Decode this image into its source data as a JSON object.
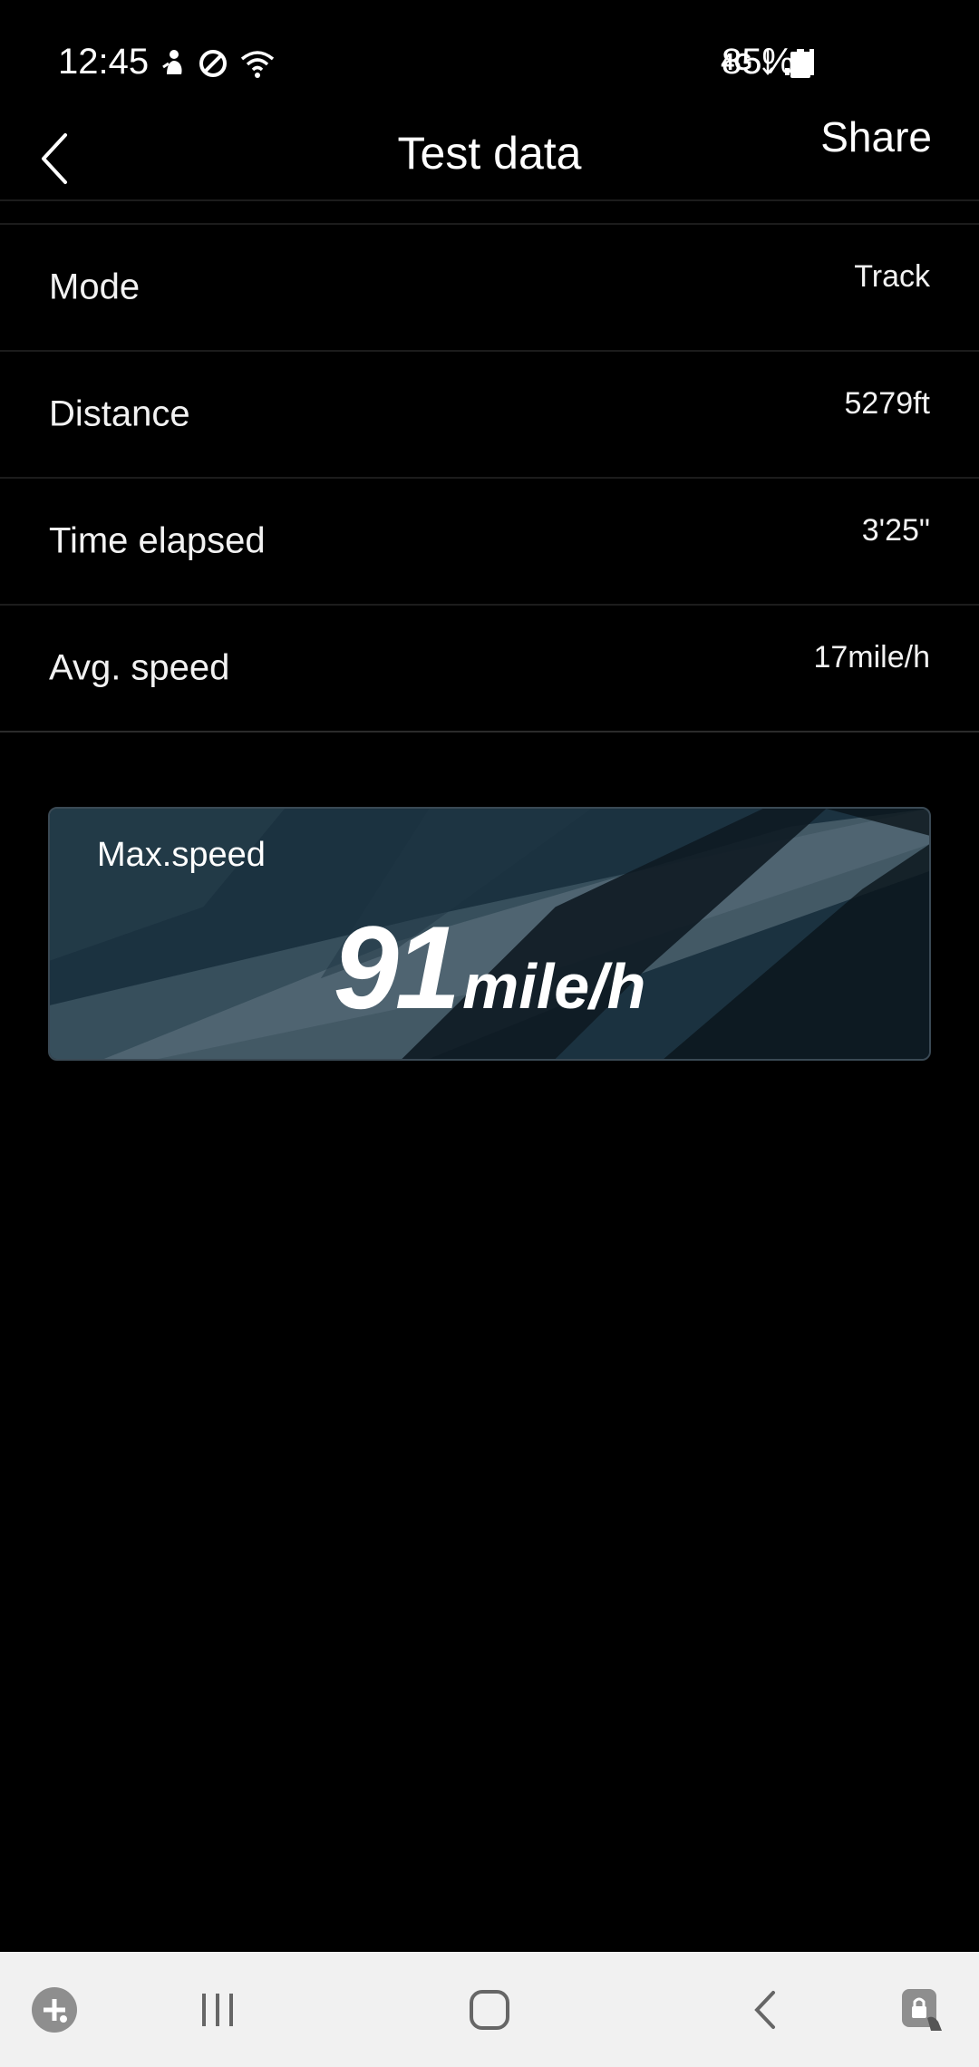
{
  "status_bar": {
    "time": "12:45",
    "network": "4G",
    "battery": "85%"
  },
  "header": {
    "title": "Test data",
    "share_label": "Share"
  },
  "rows": [
    {
      "label": "Mode",
      "value": "Track"
    },
    {
      "label": "Distance",
      "value": "5279ft"
    },
    {
      "label": "Time elapsed",
      "value": "3'25\""
    },
    {
      "label": "Avg. speed",
      "value": "17mile/h"
    }
  ],
  "max_speed": {
    "label": "Max.speed",
    "value": "91",
    "unit": "mile/h"
  },
  "icons": {
    "back": "chevron-left-icon",
    "game": "game-launcher-icon",
    "recents": "recents-icon",
    "home": "home-icon",
    "nav_back": "back-icon",
    "lock": "lock-icon"
  },
  "colors": {
    "background": "#000000",
    "divider": "#1c1c1c",
    "card": "#1d3442",
    "nav_bar": "#f1f1f1"
  }
}
